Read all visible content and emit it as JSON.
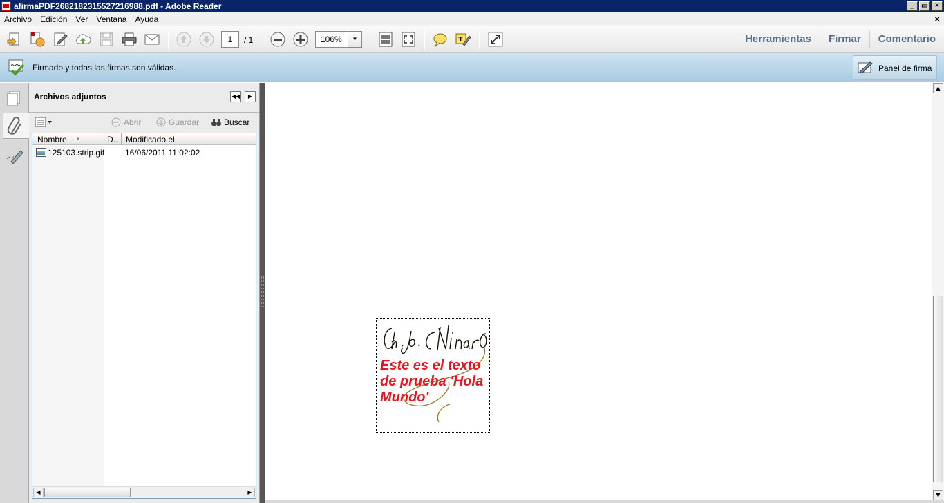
{
  "window": {
    "title": "afirmaPDF2682182315527216988.pdf - Adobe Reader",
    "controls": {
      "minimize": "_",
      "restore": "▭",
      "close": "×"
    }
  },
  "menu": {
    "items": [
      "Archivo",
      "Edición",
      "Ver",
      "Ventana",
      "Ayuda"
    ],
    "close_glyph": "×"
  },
  "toolbar": {
    "page_current": "1",
    "page_total": "/ 1",
    "zoom": "106%",
    "links": [
      "Herramientas",
      "Firmar",
      "Comentario"
    ]
  },
  "signature_bar": {
    "message": "Firmado y todas las firmas son válidas.",
    "panel_button": "Panel de firma"
  },
  "attachments_panel": {
    "title": "Archivos adjuntos",
    "tools": {
      "open": "Abrir",
      "save": "Guardar",
      "search": "Buscar"
    },
    "columns": {
      "name": "Nombre",
      "description": "D..",
      "modified": "Modificado el"
    },
    "files": [
      {
        "name": "125103.strip.gif",
        "modified": "16/06/2011 11:02:02"
      }
    ]
  },
  "document": {
    "signature_text": "Este es el texto de prueba 'Hola Mundo'",
    "handwritten_signature": "Ch. Jo. CNinard"
  },
  "colors": {
    "titlebar": "#0a246a",
    "signature_bar": "#b7d3e8",
    "signature_text": "#e8141e",
    "toolbar_links": "#5a6f86"
  }
}
